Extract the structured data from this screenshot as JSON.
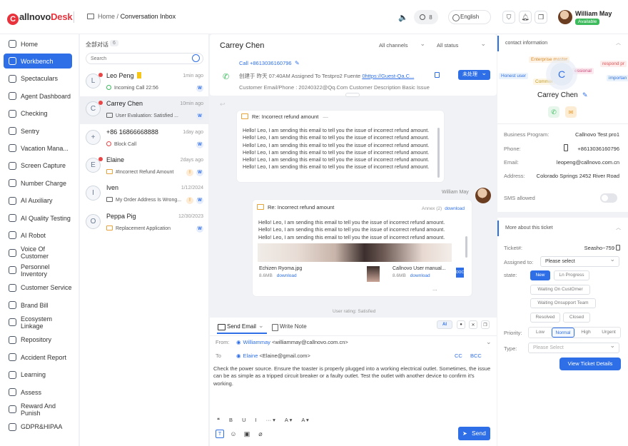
{
  "app": {
    "logo_prefix": "C",
    "logo_main": "allnovo",
    "logo_suffix": "Desk"
  },
  "breadcrumb": {
    "home": "Home",
    "sep": "/",
    "current": "Conversation Inbox"
  },
  "topbar": {
    "badge_count": "8",
    "language": "English",
    "user_name": "William May",
    "user_status": "Available"
  },
  "sidebar": {
    "items": [
      {
        "label": "Home",
        "icon": "home-icon"
      },
      {
        "label": "Workbench",
        "icon": "workbench-icon",
        "active": true
      },
      {
        "label": "Spectaculars",
        "icon": "monitor-icon"
      },
      {
        "label": "Agent Dashboard",
        "icon": "dashboard-icon"
      },
      {
        "label": "Checking",
        "icon": "check-icon"
      },
      {
        "label": "Sentry",
        "icon": "sentry-icon"
      },
      {
        "label": "Vacation Mana...",
        "icon": "vacation-icon"
      },
      {
        "label": "Screen Capture",
        "icon": "camera-icon"
      },
      {
        "label": "Number Charge",
        "icon": "phone-icon"
      },
      {
        "label": "AI Auxiliary",
        "icon": "ai-icon"
      },
      {
        "label": "AI Quality Testing",
        "icon": "quality-icon"
      },
      {
        "label": "AI Robot",
        "icon": "robot-icon"
      },
      {
        "label": "Voice Of Customer",
        "icon": "voice-icon"
      },
      {
        "label": "Personnel Inventory",
        "icon": "people-icon"
      },
      {
        "label": "Customer Service",
        "icon": "headset-icon"
      },
      {
        "label": "Brand Bill",
        "icon": "bill-icon"
      },
      {
        "label": "Ecosystem Linkage",
        "icon": "link-icon"
      },
      {
        "label": "Repository",
        "icon": "repository-icon"
      },
      {
        "label": "Accident Report",
        "icon": "warning-icon"
      },
      {
        "label": "Learning",
        "icon": "learning-icon"
      },
      {
        "label": "Assess",
        "icon": "assess-icon"
      },
      {
        "label": "Reward And Punish",
        "icon": "reward-icon"
      },
      {
        "label": "GDPR&HIPAA",
        "icon": "shield-icon"
      }
    ]
  },
  "convlist": {
    "title": "全部对话",
    "count": "6",
    "search_placeholder": "Search",
    "items": [
      {
        "initial": "L",
        "name": "Leo Peng",
        "time": "1min ago",
        "sub": "Incoming Call  22:56",
        "unread": true,
        "tag": true,
        "icon": "call-icon",
        "badge": "W"
      },
      {
        "initial": "C",
        "name": "Carrey Chen",
        "time": "10min ago",
        "sub": "User Evaluation: Satisfied ...",
        "unread": true,
        "selected": true,
        "icon": "chat-icon",
        "badge": "W"
      },
      {
        "initial": "+",
        "name": "+86 16866668888",
        "time": "1day ago",
        "sub": "Block Call",
        "icon": "block-call-icon",
        "badge": "W"
      },
      {
        "initial": "E",
        "name": "Elaine",
        "time": "2days ago",
        "sub": "#Incorrect Refund Amount",
        "unread": true,
        "icon": "email-icon",
        "badge": "W",
        "badge2": "!"
      },
      {
        "initial": "I",
        "name": "Iven",
        "time": "1/12/2024",
        "sub": "My Order Address Is Wrong...",
        "icon": "chat-icon",
        "badge": "W",
        "badge2": "!"
      },
      {
        "initial": "O",
        "name": "Peppa Pig",
        "time": "12/30/2023",
        "sub": "Replacement Application",
        "icon": "email-icon",
        "badge": "W"
      }
    ]
  },
  "main": {
    "contact_name": "Carrey Chen",
    "channel_filter": "All channels",
    "status_filter": "All status",
    "call_number": "Call +8613036160796",
    "info_line": "创建于 昨天 07:40AM   Assigned To  Testpro2   Fuente ",
    "info_link": "0https://Guest-Qa.C...",
    "status_btn": "未处理",
    "info_line2": "Customer Email/Phone : 20240322@Qq.Com      Customer Description Basic Issue",
    "email1": {
      "subject": "Re: Incorrect refund amount",
      "body": "Hello! Leo, I am sending this email to tell you the issue of incorrect refund amount. Hello! Leo, I am sending this email to tell you the issue of incorrect refund amount. Hello! Leo, I am sending this email to tell you the issue of incorrect refund amount. Hello! Leo, I am sending this email to tell you the issue of incorrect refund amount. Hello! Leo, I am sending this email to tell you the issue of incorrect refund amount. Hello! Leo, I am sending this email to tell you the issue of incorrect refund amount."
    },
    "sender_name": "William May",
    "email2": {
      "subject": "Re: Incorrect refund amount",
      "annex": "Annex (2)",
      "download": "download",
      "body": "Hello! Leo, I am sending this email to tell you the issue of incorrect refund amount. Hello! Leo, I am sending this email to tell you the issue of incorrect refund amount. Hello! Leo, I am sending this email to tell you the issue of incorrect refund amount.",
      "att1_name": "Echizen Ryoma.jpg",
      "att1_size": "8.6MB",
      "att2_name": "Callnovo User manual...",
      "att2_size": "8.6MB",
      "att_more": "..."
    },
    "rating": "User rating: Satisfied"
  },
  "compose": {
    "tab_send": "Send Email",
    "tab_note": "Write Note",
    "ai_label": "AI",
    "from_label": "From:",
    "from_name": "Williammay",
    "from_email": " <williammay@callnovo.com.cn>",
    "to_label": "To",
    "to_name": "Elaine",
    "to_email": " <Elaine@gmail.com>",
    "cc": "CC",
    "bcc": "BCC",
    "body": "Check the power source. Ensure the toaster is properly plugged into a working electrical outlet. Sometimes, the issue can be as simple as a tripped circuit breaker or a faulty outlet. Test the outlet with another device to confirm it's working.",
    "fmt": [
      "❝",
      "B",
      "U",
      "I",
      "··· ▾",
      "A ▾",
      "A ▾"
    ],
    "send": "Send"
  },
  "right": {
    "section1": "contact information",
    "tags": [
      "Enterprise master",
      "Honest user",
      "Commer",
      "essional",
      "respond pr",
      "importan"
    ],
    "avatar_initial": "C",
    "name": "Carrey Chen",
    "fields": [
      {
        "label": "Business Program:",
        "value": "Callnovo Test pro1"
      },
      {
        "label": "Phone:",
        "value": "+8613036160796"
      },
      {
        "label": "Email:",
        "value": "leopeng@callnovo.com.cn"
      },
      {
        "label": "Address:",
        "value": "Colorado Springs 2452  River Road"
      }
    ],
    "sms_label": "SMS allowed",
    "section2": "More about this ticket",
    "ticket_label": "Ticket#:",
    "ticket_value": "Seasho~759",
    "assigned_label": "Assigned to:",
    "assigned_value": "Please select",
    "state_label": "state:",
    "states": [
      "New",
      "Ln Progress",
      "Waiting On CustOmer",
      "Waiting Onsupport Team",
      "Resolved",
      "Closed"
    ],
    "priority_label": "Priority:",
    "priorities": [
      "Low",
      "Normal",
      "High",
      "Urgent"
    ],
    "type_label": "Type:",
    "type_placeholder": "Please Select",
    "view_btn": "View Ticket Details"
  }
}
